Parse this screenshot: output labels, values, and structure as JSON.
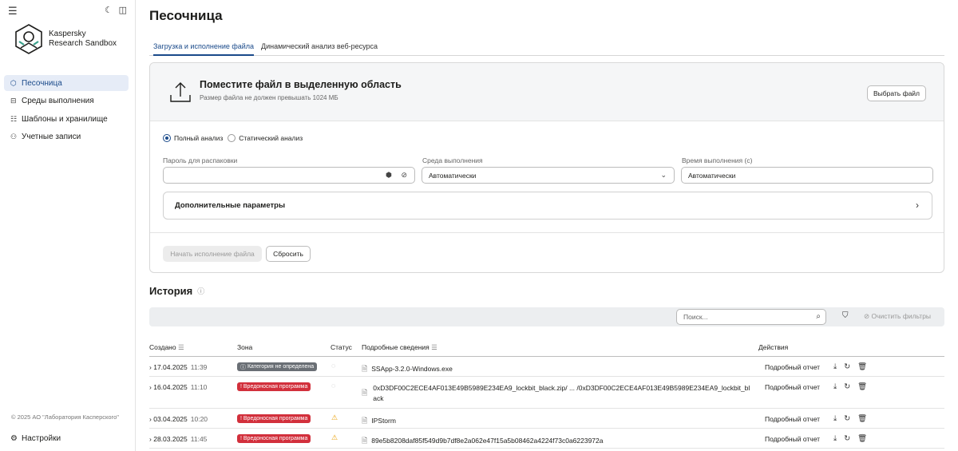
{
  "sidebar": {
    "brand_line1": "Kaspersky",
    "brand_line2": "Research Sandbox",
    "items": [
      {
        "label": "Песочница",
        "icon": "cube-icon",
        "active": true
      },
      {
        "label": "Среды выполнения",
        "icon": "environment-icon",
        "active": false
      },
      {
        "label": "Шаблоны и хранилище",
        "icon": "storage-icon",
        "active": false
      },
      {
        "label": "Учетные записи",
        "icon": "users-icon",
        "active": false
      }
    ],
    "copyright": "© 2025 АО \"Лаборатория Касперского\"",
    "settings_label": "Настройки"
  },
  "header": {
    "title": "Песочница",
    "tabs": [
      {
        "label": "Загрузка и исполнение файла",
        "active": true
      },
      {
        "label": "Динамический анализ веб-ресурса",
        "active": false
      }
    ]
  },
  "upload": {
    "title": "Поместите файл в выделенную область",
    "subtitle": "Размер файла не должен превышать 1024 МБ",
    "pick_button": "Выбрать файл",
    "analysis_modes": [
      {
        "label": "Полный анализ",
        "selected": true
      },
      {
        "label": "Статический анализ",
        "selected": false
      }
    ],
    "password_label": "Пароль для распаковки",
    "password_value": "",
    "env_label": "Среда выполнения",
    "env_value": "Автоматически",
    "time_label": "Время выполнения (с)",
    "time_value": "Автоматически",
    "advanced_label": "Дополнительные параметры",
    "start_button": "Начать исполнение файла",
    "reset_button": "Сбросить"
  },
  "history": {
    "title": "История",
    "search_placeholder": "Поиск...",
    "clear_filters": "Очистить фильтры",
    "columns": {
      "created": "Создано",
      "zone": "Зона",
      "status": "Статус",
      "details": "Подробные сведения",
      "actions": "Действия"
    },
    "rows": [
      {
        "date": "17.04.2025",
        "time": "11:39",
        "zone": "Категория не определена",
        "zone_color": "grey",
        "status": "ok",
        "details": "SSApp-3.2.0-Windows.exe",
        "report": "Подробный отчет"
      },
      {
        "date": "16.04.2025",
        "time": "11:10",
        "zone": "Вредоносная программа",
        "zone_color": "red",
        "status": "ok",
        "details": "0xD3DF00C2ECE4AF013E49B5989E234EA9_lockbit_black.zip/ ... /0xD3DF00C2ECE4AF013E49B5989E234EA9_lockbit_black",
        "report": "Подробный отчет"
      },
      {
        "date": "03.04.2025",
        "time": "10:20",
        "zone": "Вредоносная программа",
        "zone_color": "red",
        "status": "warn",
        "details": "IPStorm",
        "report": "Подробный отчет"
      },
      {
        "date": "28.03.2025",
        "time": "11:45",
        "zone": "Вредоносная программа",
        "zone_color": "red",
        "status": "warn",
        "details": "89e5b8208daf85f549d9b7df8e2a062e47f15a5b08462a4224f73c0a6223972a",
        "report": "Подробный отчет"
      }
    ]
  },
  "colors": {
    "accent": "#1a4a8a",
    "danger": "#d2303c",
    "neutral_badge": "#6a6f75",
    "warning": "#e9a20c"
  }
}
